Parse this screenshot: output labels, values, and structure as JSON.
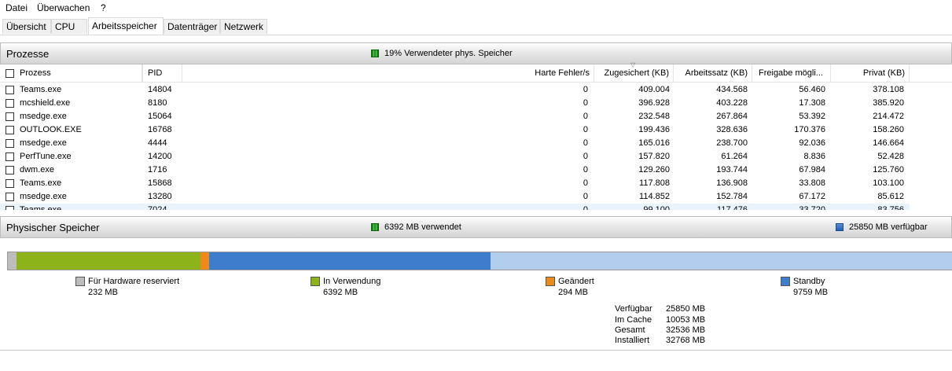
{
  "menu": {
    "file": "Datei",
    "monitor": "Überwachen",
    "help": "?"
  },
  "tabs": [
    "Übersicht",
    "CPU",
    "Arbeitsspeicher",
    "Datenträger",
    "Netzwerk"
  ],
  "processes": {
    "title": "Prozesse",
    "usage_label": "19% Verwendeter phys. Speicher",
    "columns": {
      "process": "Prozess",
      "pid": "PID",
      "hard_faults": "Harte Fehler/s",
      "commit": "Zugesichert (KB)",
      "working_set": "Arbeitssatz (KB)",
      "shareable": "Freigabe mögli...",
      "private": "Privat (KB)"
    },
    "rows": [
      [
        "Teams.exe",
        "14804",
        "0",
        "409.004",
        "434.568",
        "56.460",
        "378.108"
      ],
      [
        "mcshield.exe",
        "8180",
        "0",
        "396.928",
        "403.228",
        "17.308",
        "385.920"
      ],
      [
        "msedge.exe",
        "15064",
        "0",
        "232.548",
        "267.864",
        "53.392",
        "214.472"
      ],
      [
        "OUTLOOK.EXE",
        "16768",
        "0",
        "199.436",
        "328.636",
        "170.376",
        "158.260"
      ],
      [
        "msedge.exe",
        "4444",
        "0",
        "165.016",
        "238.700",
        "92.036",
        "146.664"
      ],
      [
        "PerfTune.exe",
        "14200",
        "0",
        "157.820",
        "61.264",
        "8.836",
        "52.428"
      ],
      [
        "dwm.exe",
        "1716",
        "0",
        "129.260",
        "193.744",
        "67.984",
        "125.760"
      ],
      [
        "Teams.exe",
        "15868",
        "0",
        "117.808",
        "136.908",
        "33.808",
        "103.100"
      ],
      [
        "msedge.exe",
        "13280",
        "0",
        "114.852",
        "152.784",
        "67.172",
        "85.612"
      ],
      [
        "Teams.exe",
        "7024",
        "0",
        "99.100",
        "117.476",
        "33.720",
        "83.756"
      ]
    ]
  },
  "physical": {
    "title": "Physischer Speicher",
    "used_label": "6392 MB verwendet",
    "available_label": "25850 MB verfügbar",
    "colors": {
      "hardware": "#bdbdbd",
      "in_use": "#8cb31a",
      "modified": "#ed8a1a",
      "standby": "#3d7dcc",
      "free": "#b2cdee"
    },
    "segments_mb": {
      "hardware": 232,
      "in_use": 6392,
      "modified": 294,
      "standby": 9759,
      "free": 16091
    },
    "legend": [
      {
        "name": "Für Hardware reserviert",
        "value": "232 MB"
      },
      {
        "name": "In Verwendung",
        "value": "6392 MB"
      },
      {
        "name": "Geändert",
        "value": "294 MB"
      },
      {
        "name": "Standby",
        "value": "9759 MB"
      }
    ],
    "stats": [
      {
        "label": "Verfügbar",
        "value": "25850 MB"
      },
      {
        "label": "Im Cache",
        "value": "10053 MB"
      },
      {
        "label": "Gesamt",
        "value": "32536 MB"
      },
      {
        "label": "Installiert",
        "value": "32768 MB"
      }
    ]
  }
}
